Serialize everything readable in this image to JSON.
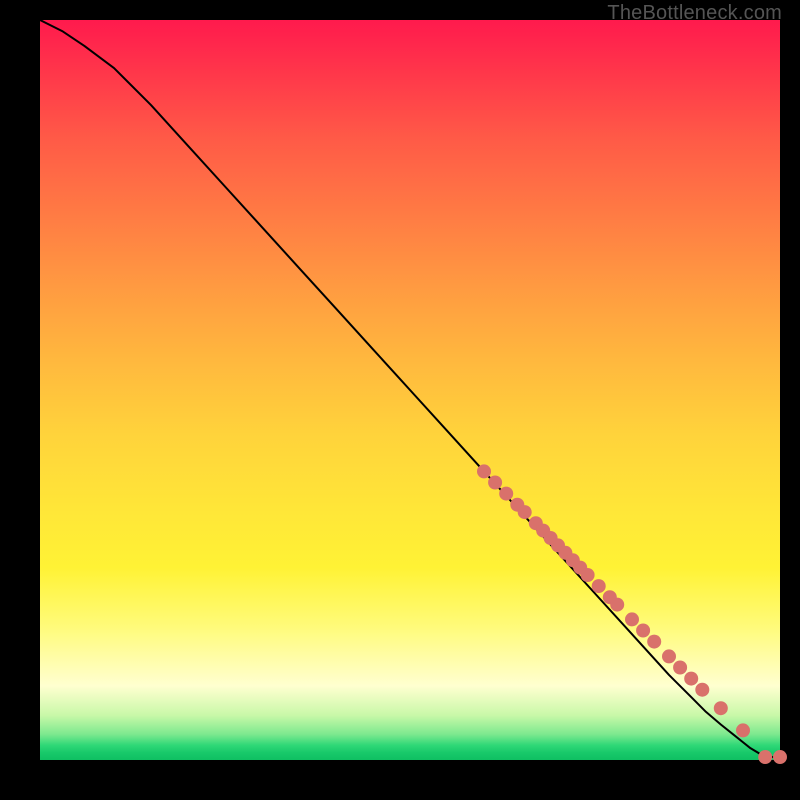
{
  "attribution": "TheBottleneck.com",
  "chart_data": {
    "type": "line",
    "title": "",
    "xlabel": "",
    "ylabel": "",
    "xlim": [
      0,
      100
    ],
    "ylim": [
      0,
      100
    ],
    "series": [
      {
        "name": "curve",
        "x": [
          0,
          3,
          6,
          10,
          15,
          20,
          25,
          30,
          35,
          40,
          45,
          50,
          55,
          60,
          65,
          70,
          75,
          80,
          85,
          88,
          90,
          92,
          94,
          95,
          96,
          98,
          100
        ],
        "y": [
          100,
          98.5,
          96.5,
          93.5,
          88.5,
          83,
          77.5,
          72,
          66.5,
          61,
          55.5,
          50,
          44.5,
          39,
          33.5,
          28,
          22.5,
          17,
          11.5,
          8.5,
          6.5,
          4.8,
          3.2,
          2.4,
          1.6,
          0.4,
          0.4
        ]
      }
    ],
    "points": {
      "name": "markers",
      "color": "#d9716b",
      "x": [
        60,
        61.5,
        63,
        64.5,
        65.5,
        67,
        68,
        69,
        70,
        71,
        72,
        73,
        74,
        75.5,
        77,
        78,
        80,
        81.5,
        83,
        85,
        86.5,
        88,
        89.5,
        92,
        95,
        98,
        100
      ],
      "y": [
        39,
        37.5,
        36,
        34.5,
        33.5,
        32,
        31,
        30,
        29,
        28,
        27,
        26,
        25,
        23.5,
        22,
        21,
        19,
        17.5,
        16,
        14,
        12.5,
        11,
        9.5,
        7,
        4,
        0.4,
        0.4
      ]
    }
  }
}
